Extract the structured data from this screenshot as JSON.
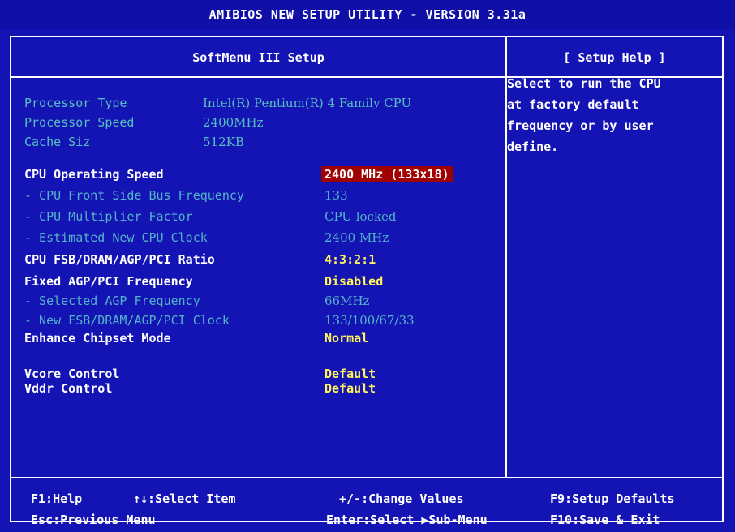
{
  "title": "AMIBIOS NEW SETUP UTILITY - VERSION 3.31a",
  "panel_title": "SoftMenu III Setup",
  "help_title": "[  Setup Help  ]",
  "info": [
    {
      "label": "Processor Type",
      "value": "Intel(R) Pentium(R) 4 Family CPU"
    },
    {
      "label": "Processor Speed",
      "value": "2400MHz"
    },
    {
      "label": "Cache Siz",
      "value": "512KB"
    }
  ],
  "settings": [
    {
      "label": "CPU Operating Speed",
      "value": "2400 MHz (133x18)",
      "state": "selected"
    },
    {
      "label": "- CPU Front Side Bus Frequency",
      "value": "133",
      "state": "disabled"
    },
    {
      "label": "- CPU Multiplier Factor",
      "value": "CPU locked",
      "state": "disabled"
    },
    {
      "label": "- Estimated New CPU Clock",
      "value": "2400 MHz",
      "state": "disabled"
    },
    {
      "label": "CPU FSB/DRAM/AGP/PCI Ratio",
      "value": "4:3:2:1",
      "state": "enabled"
    },
    {
      "label": "Fixed AGP/PCI Frequency",
      "value": "Disabled",
      "state": "enabled"
    },
    {
      "label": "- Selected AGP Frequency",
      "value": "66MHz",
      "state": "disabled"
    },
    {
      "label": "- New FSB/DRAM/AGP/PCI Clock",
      "value": "133/100/67/33",
      "state": "disabled"
    },
    {
      "label": "Enhance Chipset Mode",
      "value": "Normal",
      "state": "enabled"
    },
    {
      "label": "Vcore Control",
      "value": "Default",
      "state": "enabled"
    },
    {
      "label": "Vddr Control",
      "value": "Default",
      "state": "enabled"
    }
  ],
  "help_text": [
    "Select to run the CPU",
    "at factory default",
    "frequency or by user",
    "define."
  ],
  "footer": {
    "f1": "F1:Help",
    "select_item": "↑↓:Select Item",
    "change_values": "+/-:Change Values",
    "f9": "F9:Setup Defaults",
    "esc": "Esc:Previous Menu",
    "enter": "Enter:Select ▶Sub-Menu",
    "f10": "F10:Save & Exit"
  },
  "colors": {
    "background": "#1414b4",
    "highlight": "#a00000",
    "value": "#fff45a",
    "disabled": "#52b4c8"
  }
}
